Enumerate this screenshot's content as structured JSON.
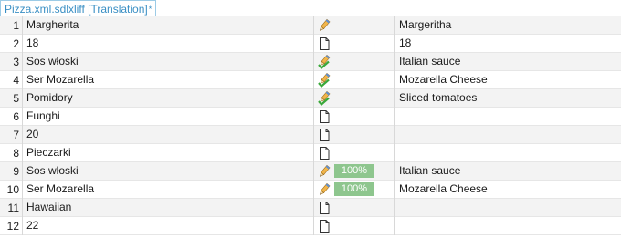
{
  "tab": {
    "label": "Pizza.xml.sdlxliff [Translation]",
    "dirty_marker": "*"
  },
  "rows": [
    {
      "num": "1",
      "source": "Margherita",
      "status": "draft-icon",
      "match": "",
      "target": "Margeritha"
    },
    {
      "num": "2",
      "source": "18",
      "status": "not-translated-icon",
      "match": "",
      "target": "18"
    },
    {
      "num": "3",
      "source": "Sos włoski",
      "status": "translated-icon",
      "match": "",
      "target": "Italian sauce"
    },
    {
      "num": "4",
      "source": "Ser Mozarella",
      "status": "translated-icon",
      "match": "",
      "target": "Mozarella Cheese"
    },
    {
      "num": "5",
      "source": "Pomidory",
      "status": "translated-icon",
      "match": "",
      "target": "Sliced tomatoes"
    },
    {
      "num": "6",
      "source": "Funghi",
      "status": "not-translated-icon",
      "match": "",
      "target": ""
    },
    {
      "num": "7",
      "source": "20",
      "status": "not-translated-icon",
      "match": "",
      "target": ""
    },
    {
      "num": "8",
      "source": "Pieczarki",
      "status": "not-translated-icon",
      "match": "",
      "target": ""
    },
    {
      "num": "9",
      "source": "Sos włoski",
      "status": "draft-icon",
      "match": "100%",
      "target": "Italian sauce"
    },
    {
      "num": "10",
      "source": "Ser Mozarella",
      "status": "draft-icon",
      "match": "100%",
      "target": "Mozarella Cheese"
    },
    {
      "num": "11",
      "source": "Hawaiian",
      "status": "not-translated-icon",
      "match": "",
      "target": ""
    },
    {
      "num": "12",
      "source": "22",
      "status": "not-translated-icon",
      "match": "",
      "target": ""
    }
  ],
  "colors": {
    "accent": "#2b9fd6",
    "match_bg": "#8ec68e",
    "translated_check": "#3aa83a"
  }
}
